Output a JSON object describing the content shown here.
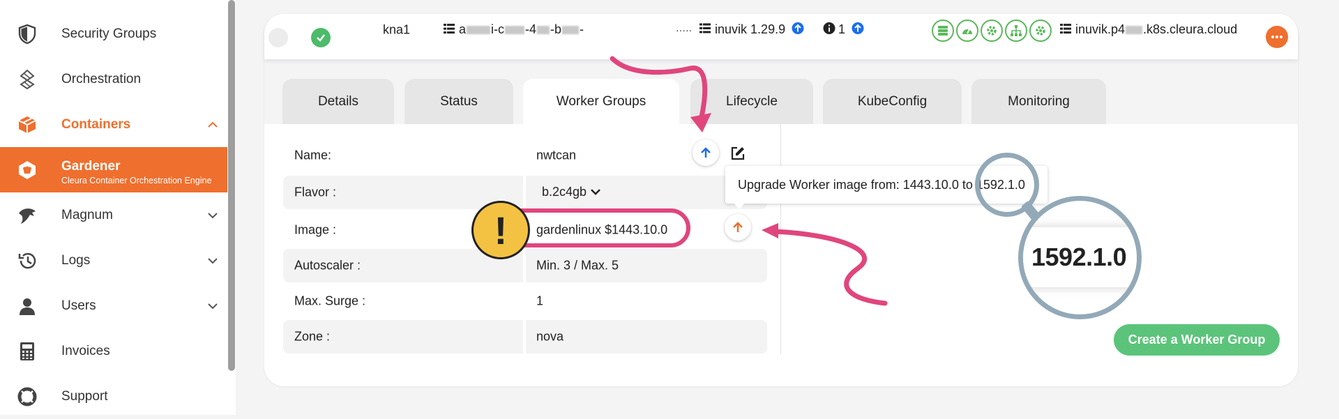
{
  "sidebar": {
    "items": [
      {
        "label": "Security Groups",
        "icon": "shield-icon"
      },
      {
        "label": "Orchestration",
        "icon": "orchestration-icon"
      },
      {
        "label": "Containers",
        "icon": "containers-icon"
      },
      {
        "label": "Gardener",
        "sublabel": "Cleura Container Orchestration Engine",
        "icon": "gardener-icon"
      },
      {
        "label": "Magnum",
        "icon": "magnum-icon"
      },
      {
        "label": "Logs",
        "icon": "logs-icon"
      },
      {
        "label": "Users",
        "icon": "user-icon"
      },
      {
        "label": "Invoices",
        "icon": "calculator-icon"
      },
      {
        "label": "Support",
        "icon": "lifebuoy-icon"
      }
    ]
  },
  "cluster": {
    "region": "kna1",
    "name_prefix": "a",
    "name_mid": "i-c",
    "name_mid2": "-4",
    "name_mid3": "-b",
    "name_suffix": "-",
    "dots": "·····",
    "project": "inuvik",
    "version": "1.29.9",
    "info_count": "1",
    "domain_prefix": "inuvik.p4",
    "domain_suffix": ".k8s.cleura.cloud"
  },
  "tabs": [
    {
      "label": "Details"
    },
    {
      "label": "Status"
    },
    {
      "label": "Worker Groups"
    },
    {
      "label": "Lifecycle"
    },
    {
      "label": "KubeConfig"
    },
    {
      "label": "Monitoring"
    }
  ],
  "worker_group": {
    "name_label": "Name:",
    "name_value": "nwtcan",
    "flavor_label": "Flavor :",
    "flavor_value": "b.2c4gb",
    "image_label": "Image :",
    "image_value": "gardenlinux $1443.10.0",
    "autoscaler_label": "Autoscaler :",
    "autoscaler_value": "Min. 3 / Max. 5",
    "maxsurge_label": "Max. Surge :",
    "maxsurge_value": "1",
    "zone_label": "Zone :",
    "zone_value": "nova"
  },
  "tooltip": {
    "text_prefix": "Upgrade Worker image from: 1443.10.0 to ",
    "text_version": "1592.1.0"
  },
  "zoom": {
    "text": "1592.1.0"
  },
  "warning": {
    "glyph": "!"
  },
  "create_button": {
    "label": "Create a Worker Group"
  },
  "colors": {
    "accent": "#ef6f2e",
    "success": "#5cb85c",
    "create_button": "#5bc47a",
    "annotation_pink": "#e0467c",
    "lens": "#93a9b7",
    "info_blue": "#1a6df0"
  }
}
